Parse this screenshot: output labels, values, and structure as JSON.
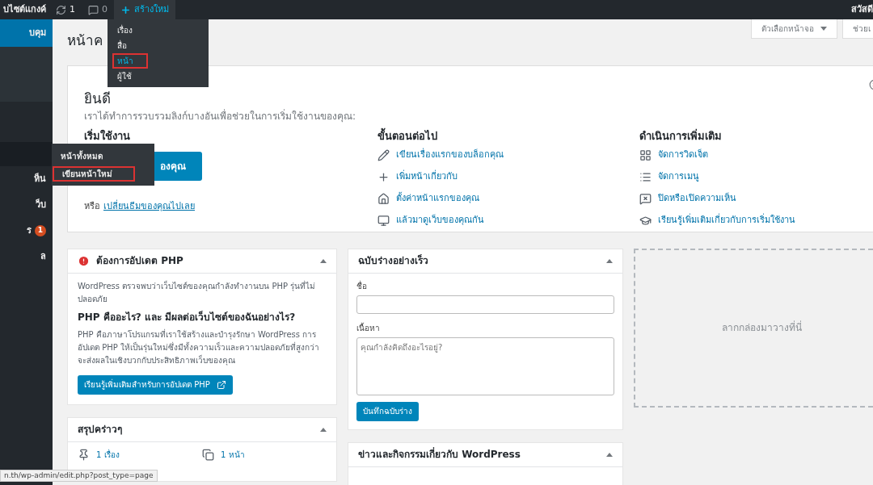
{
  "admin_bar": {
    "site_name": "บไซต์แกงค์",
    "updates": "1",
    "comments": "0",
    "new_label": "สร้างใหม่",
    "new_open": true,
    "greeting": "สวัสดี"
  },
  "new_menu": [
    {
      "label": "เรื่อง",
      "highlighted": false
    },
    {
      "label": "สื่อ",
      "highlighted": false
    },
    {
      "label": "หน้า",
      "highlighted": true
    },
    {
      "label": "ผู้ใช้",
      "highlighted": false
    }
  ],
  "sidebar": {
    "items": [
      {
        "label": "บคุม",
        "kind": "current"
      },
      {
        "kind": "submenu"
      },
      {
        "kind": "hover"
      },
      {
        "label": "ห็น",
        "kind": "item"
      },
      {
        "label": "ว็บ",
        "kind": "item"
      },
      {
        "label": "ร",
        "kind": "item",
        "badge": "1"
      },
      {
        "label": "ล",
        "kind": "item"
      }
    ]
  },
  "flyout": [
    {
      "label": "หน้าทั้งหมด",
      "highlighted": false
    },
    {
      "label": "เขียนหน้าใหม่",
      "highlighted": true
    }
  ],
  "page_title": "หน้าค",
  "screen_buttons": [
    {
      "label": "ตัวเลือกหน้าจอ",
      "caret": true
    },
    {
      "label": "ช่วยเ",
      "caret": false
    }
  ],
  "welcome": {
    "title": "ยินดี",
    "subtitle": "เราได้ทำการรวบรวมลิงก์บางอันเพื่อช่วยในการเริ่มใช้งานของคุณ:",
    "start": {
      "heading": "เริ่มใช้งาน",
      "button": "องคุณ",
      "or": "หรือ",
      "link": "เปลี่ยนธีมของคุณไปเลย"
    },
    "next": {
      "heading": "ขั้นตอนต่อไป",
      "links": [
        "เขียนเรื่องแรกของบล็อกคุณ",
        "เพิ่มหน้าเกี่ยวกับ",
        "ตั้งค่าหน้าแรกของคุณ",
        "แล้วมาดูเว็บของคุณกัน"
      ]
    },
    "more": {
      "heading": "ดำเนินการเพิ่มเติม",
      "links": [
        "จัดการวิดเจ็ต",
        "จัดการเมนู",
        "ปิดหรือเปิดความเห็น",
        "เรียนรู้เพิ่มเติมเกี่ยวกับการเริ่มใช้งาน"
      ]
    }
  },
  "php_box": {
    "title": "ต้องการอัปเดต PHP",
    "intro": "WordPress ตรวจพบว่าเว็บไซต์ของคุณกำลังทำงานบน PHP รุ่นที่ไม่ปลอดภัย",
    "question": "PHP คืออะไร? และ มีผลต่อเว็บไซต์ของฉันอย่างไร?",
    "body": "PHP คือภาษาโปรแกรมที่เราใช้สร้างและบำรุงรักษา WordPress การอัปเดต PHP ให้เป็นรุ่นใหม่ซึ่งมีทั้งความเร็วและความปลอดภัยที่สูงกว่า จะส่งผลในเชิงบวกกับประสิทธิภาพเว็บของคุณ",
    "button": "เรียนรู้เพิ่มเติมสำหรับการอัปเดต PHP"
  },
  "glance": {
    "title": "สรุปคร่าวๆ",
    "items": [
      "1 เรื่อง",
      "1 หน้า"
    ]
  },
  "quick_draft": {
    "title": "ฉบับร่างอย่างเร็ว",
    "title_label": "ชื่อ",
    "content_label": "เนื้อหา",
    "content_placeholder": "คุณกำลังคิดถึงอะไรอยู่?",
    "button": "บันทึกฉบับร่าง"
  },
  "news": {
    "title": "ข่าวและกิจกรรมเกี่ยวกับ WordPress"
  },
  "drop_zone": "ลากกล่องมาวางที่นี่",
  "status_url": "n.th/wp-admin/edit.php?post_type=page"
}
